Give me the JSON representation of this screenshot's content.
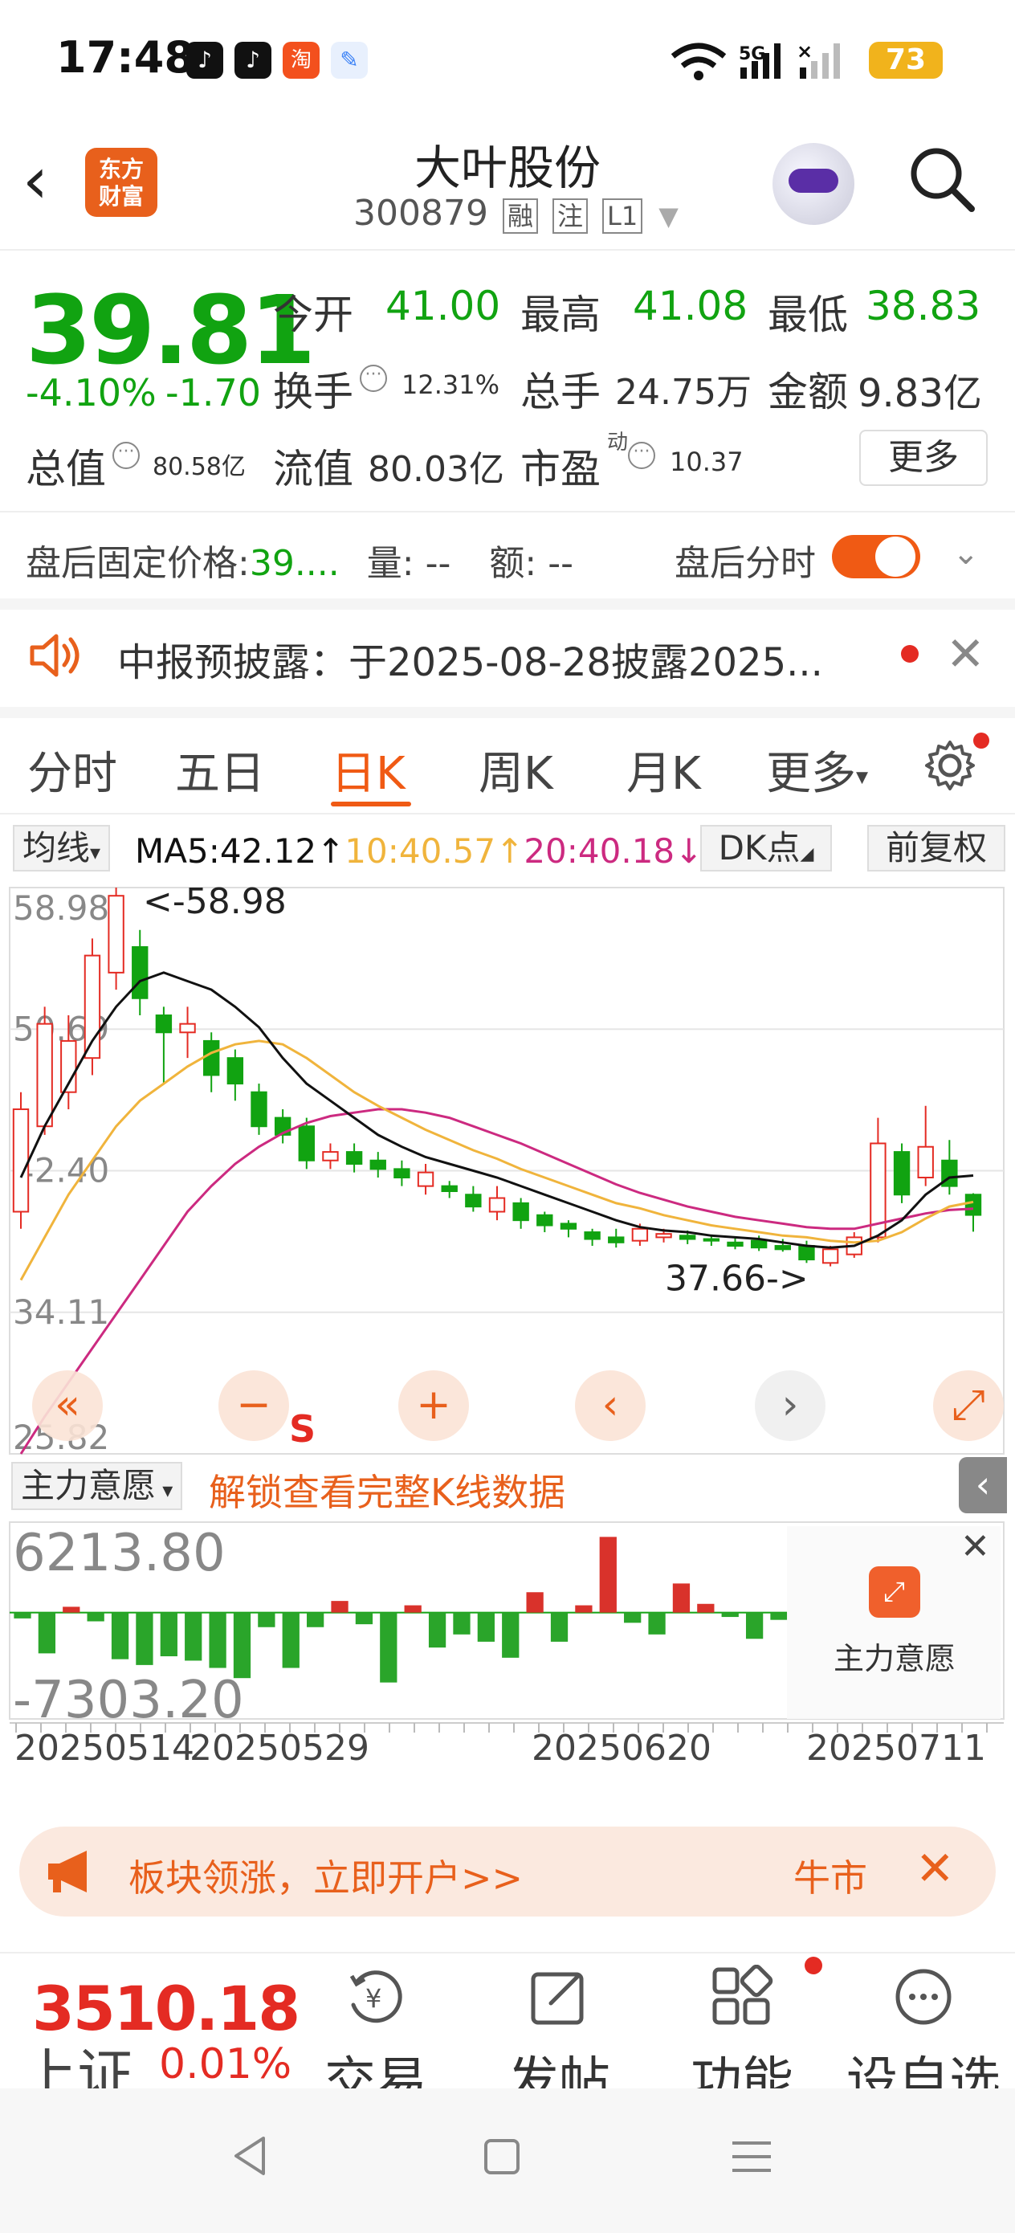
{
  "status_bar": {
    "time": "17:48",
    "battery": "73",
    "signal": "5G"
  },
  "header": {
    "logo_line1": "东方",
    "logo_line2": "财富",
    "stock_name": "大叶股份",
    "stock_code": "300879",
    "tags": [
      "融",
      "注",
      "L1"
    ]
  },
  "quote": {
    "price": "39.81",
    "change_pct": "-4.10%",
    "change_amt": "-1.70",
    "open_label": "今开",
    "open": "41.00",
    "high_label": "最高",
    "high": "41.08",
    "low_label": "最低",
    "low": "38.83",
    "turnover_label": "换手",
    "turnover": "12.31%",
    "volume_label": "总手",
    "volume": "24.75万",
    "amount_label": "金额",
    "amount": "9.83亿",
    "mktcap_label": "总值",
    "mktcap": "80.58亿",
    "float_label": "流值",
    "float_cap": "80.03亿",
    "pe_label": "市盈",
    "pe_sup": "动",
    "pe": "10.37",
    "more": "更多"
  },
  "after_hours": {
    "label": "盘后固定价格:",
    "price": "39....",
    "vol_label": "量:",
    "vol": "--",
    "amt_label": "额:",
    "amt": "--",
    "toggle_label": "盘后分时",
    "toggle_on": true
  },
  "notice": {
    "text": "中报预披露：于2025-08-28披露2025..."
  },
  "tabs": [
    {
      "label": "分时",
      "active": false
    },
    {
      "label": "五日",
      "active": false
    },
    {
      "label": "日K",
      "active": true
    },
    {
      "label": "周K",
      "active": false
    },
    {
      "label": "月K",
      "active": false
    },
    {
      "label": "更多",
      "active": false
    }
  ],
  "ma_bar": {
    "select": "均线",
    "ma5": "MA5:42.12↑",
    "ma10": "10:40.57↑",
    "ma20": "20:40.18↓",
    "dk": "DK点",
    "adjust": "前复权"
  },
  "colors": {
    "up": "#e42b23",
    "down": "#11a311",
    "ma5": "#111111",
    "ma10": "#f0b43c",
    "ma20": "#cc2a80",
    "accent": "#f05a14"
  },
  "chart_data": [
    {
      "type": "candlestick",
      "title": "日K",
      "y_ticks": [
        "58.98",
        "50.69",
        "42.40",
        "34.11",
        "25.82"
      ],
      "ylim": [
        25.82,
        58.98
      ],
      "annotations": {
        "max": "<-58.98",
        "min": "37.66->",
        "signal": "S"
      },
      "candles": [
        {
          "o": 40.0,
          "c": 46.0,
          "h": 47.0,
          "l": 39.0
        },
        {
          "o": 45.0,
          "c": 51.0,
          "h": 52.0,
          "l": 44.5
        },
        {
          "o": 47.0,
          "c": 50.0,
          "h": 51.5,
          "l": 46.0
        },
        {
          "o": 49.0,
          "c": 55.0,
          "h": 56.0,
          "l": 48.0
        },
        {
          "o": 54.0,
          "c": 58.5,
          "h": 58.98,
          "l": 53.0
        },
        {
          "o": 55.5,
          "c": 52.5,
          "h": 56.5,
          "l": 51.5
        },
        {
          "o": 51.5,
          "c": 50.5,
          "h": 52.0,
          "l": 47.5
        },
        {
          "o": 50.5,
          "c": 51.0,
          "h": 52.0,
          "l": 49.0
        },
        {
          "o": 50.0,
          "c": 48.0,
          "h": 50.5,
          "l": 47.0
        },
        {
          "o": 49.0,
          "c": 47.5,
          "h": 49.5,
          "l": 46.5
        },
        {
          "o": 47.0,
          "c": 45.0,
          "h": 47.5,
          "l": 44.5
        },
        {
          "o": 45.5,
          "c": 44.5,
          "h": 46.0,
          "l": 44.0
        },
        {
          "o": 45.0,
          "c": 43.0,
          "h": 45.5,
          "l": 42.5
        },
        {
          "o": 43.0,
          "c": 43.5,
          "h": 44.0,
          "l": 42.5
        },
        {
          "o": 43.5,
          "c": 42.8,
          "h": 44.0,
          "l": 42.3
        },
        {
          "o": 43.0,
          "c": 42.5,
          "h": 43.5,
          "l": 42.0
        },
        {
          "o": 42.5,
          "c": 42.0,
          "h": 43.0,
          "l": 41.5
        },
        {
          "o": 41.5,
          "c": 42.3,
          "h": 42.8,
          "l": 41.0
        },
        {
          "o": 41.5,
          "c": 41.2,
          "h": 41.8,
          "l": 40.8
        },
        {
          "o": 41.0,
          "c": 40.3,
          "h": 41.5,
          "l": 40.0
        },
        {
          "o": 40.0,
          "c": 40.8,
          "h": 41.5,
          "l": 39.5
        },
        {
          "o": 40.5,
          "c": 39.5,
          "h": 40.8,
          "l": 39.0
        },
        {
          "o": 39.8,
          "c": 39.2,
          "h": 40.0,
          "l": 38.8
        },
        {
          "o": 39.3,
          "c": 39.0,
          "h": 39.5,
          "l": 38.5
        },
        {
          "o": 38.8,
          "c": 38.4,
          "h": 39.0,
          "l": 38.0
        },
        {
          "o": 38.5,
          "c": 38.2,
          "h": 39.0,
          "l": 37.9
        },
        {
          "o": 38.3,
          "c": 39.0,
          "h": 39.3,
          "l": 38.0
        },
        {
          "o": 38.5,
          "c": 38.7,
          "h": 39.0,
          "l": 38.2
        },
        {
          "o": 38.6,
          "c": 38.4,
          "h": 38.9,
          "l": 38.1
        },
        {
          "o": 38.4,
          "c": 38.3,
          "h": 38.6,
          "l": 38.0
        },
        {
          "o": 38.2,
          "c": 38.0,
          "h": 38.5,
          "l": 37.8
        },
        {
          "o": 38.3,
          "c": 37.9,
          "h": 38.6,
          "l": 37.7
        },
        {
          "o": 38.0,
          "c": 37.8,
          "h": 38.4,
          "l": 37.66
        },
        {
          "o": 38.0,
          "c": 37.2,
          "h": 38.3,
          "l": 37.0
        },
        {
          "o": 37.0,
          "c": 37.8,
          "h": 38.0,
          "l": 36.8
        },
        {
          "o": 37.5,
          "c": 38.5,
          "h": 38.8,
          "l": 37.3
        },
        {
          "o": 38.5,
          "c": 44.0,
          "h": 45.5,
          "l": 38.2
        },
        {
          "o": 43.5,
          "c": 41.0,
          "h": 44.0,
          "l": 40.5
        },
        {
          "o": 42.0,
          "c": 43.8,
          "h": 46.2,
          "l": 41.5
        },
        {
          "o": 43.0,
          "c": 41.5,
          "h": 44.2,
          "l": 41.0
        },
        {
          "o": 41.0,
          "c": 39.81,
          "h": 41.08,
          "l": 38.83
        }
      ],
      "ma5": [
        42.0,
        45.0,
        47.5,
        50.0,
        52.0,
        53.5,
        54.0,
        53.5,
        53.0,
        52.0,
        50.8,
        49.0,
        47.5,
        46.5,
        45.5,
        44.5,
        43.8,
        43.2,
        42.8,
        42.4,
        42.0,
        41.5,
        41.0,
        40.5,
        40.0,
        39.5,
        39.1,
        38.9,
        38.8,
        38.6,
        38.5,
        38.4,
        38.2,
        38.0,
        37.9,
        38.0,
        38.6,
        39.5,
        41.0,
        42.0,
        42.12
      ],
      "ma10": [
        36.0,
        38.5,
        41.0,
        43.0,
        45.0,
        46.5,
        47.5,
        48.5,
        49.3,
        49.8,
        50.0,
        49.8,
        49.0,
        48.0,
        47.0,
        46.2,
        45.5,
        44.8,
        44.2,
        43.6,
        43.1,
        42.5,
        42.0,
        41.5,
        41.0,
        40.5,
        40.2,
        39.8,
        39.5,
        39.2,
        39.0,
        38.8,
        38.6,
        38.5,
        38.3,
        38.2,
        38.3,
        38.8,
        39.6,
        40.3,
        40.57
      ],
      "ma20": [
        25.82,
        28.0,
        30.0,
        32.0,
        34.0,
        36.0,
        38.0,
        40.0,
        41.5,
        42.8,
        43.8,
        44.6,
        45.2,
        45.6,
        45.8,
        46.0,
        46.0,
        45.8,
        45.5,
        45.0,
        44.5,
        44.0,
        43.4,
        42.8,
        42.2,
        41.6,
        41.1,
        40.7,
        40.3,
        40.0,
        39.7,
        39.5,
        39.3,
        39.1,
        39.0,
        39.0,
        39.3,
        39.6,
        39.9,
        40.1,
        40.18
      ]
    },
    {
      "type": "bar",
      "title": "主力意愿",
      "y_ticks": [
        "6213.80",
        "-7303.20"
      ],
      "ylim": [
        -7303.2,
        6213.8
      ],
      "values": [
        -400,
        -2800,
        400,
        -600,
        -3200,
        -3600,
        -3000,
        -3300,
        -3800,
        -4500,
        -1000,
        -3800,
        -1000,
        800,
        -800,
        -4800,
        500,
        -2400,
        -1500,
        -2000,
        -3100,
        1400,
        -2000,
        500,
        5200,
        -700,
        -1500,
        2000,
        600,
        -300,
        -1800,
        -500
      ],
      "x_labels": [
        "20250514",
        "20250529",
        "20250620",
        "20250711"
      ]
    }
  ],
  "indicator": {
    "select": "主力意愿",
    "unlock": "解锁查看完整K线数据",
    "lock_label": "主力意愿"
  },
  "banner": {
    "text": "板块领涨，立即开户>>",
    "right": "牛市"
  },
  "bottom_bar": {
    "index_value": "3510.18",
    "index_name": "上证",
    "index_change": "0.01%",
    "items": [
      "交易",
      "发帖",
      "功能",
      "设自选"
    ]
  }
}
